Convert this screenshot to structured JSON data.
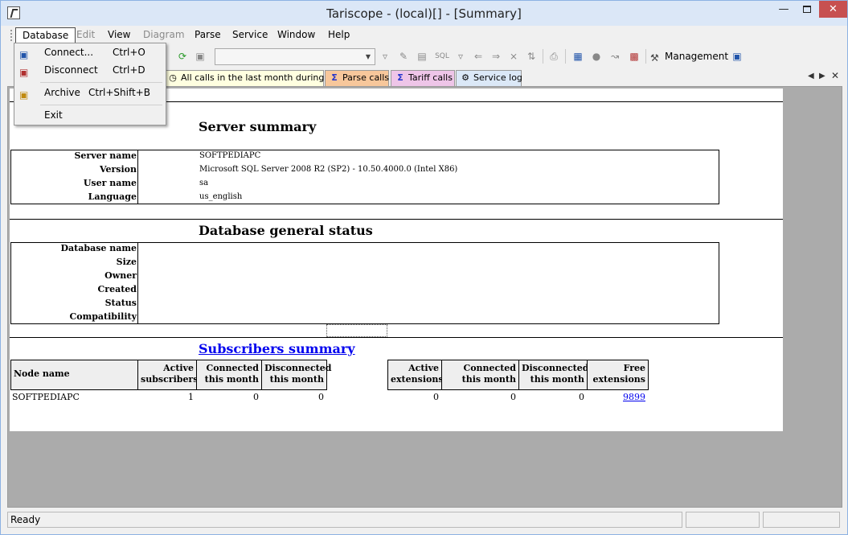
{
  "window": {
    "title": "Tariscope - (local)[] - [Summary]"
  },
  "menubar": {
    "items": [
      {
        "label": "Database"
      },
      {
        "label": "Edit"
      },
      {
        "label": "View"
      },
      {
        "label": "Diagram"
      },
      {
        "label": "Parse"
      },
      {
        "label": "Service"
      },
      {
        "label": "Window"
      },
      {
        "label": "Help"
      }
    ]
  },
  "database_menu": {
    "items": [
      {
        "label": "Connect...",
        "shortcut": "Ctrl+O"
      },
      {
        "label": "Disconnect",
        "shortcut": "Ctrl+D"
      },
      {
        "label": "Archive",
        "shortcut": "Ctrl+Shift+B"
      },
      {
        "label": "Exit",
        "shortcut": ""
      }
    ]
  },
  "toolbar": {
    "management_label": "Management"
  },
  "tabs": [
    {
      "label": "All calls in the last month during off-h",
      "color": "#ffffe0"
    },
    {
      "label": "Parse calls",
      "color": "#f7c79b"
    },
    {
      "label": "Tariff calls",
      "color": "#eec5e8"
    },
    {
      "label": "Service log",
      "color": "#dbe8f7"
    }
  ],
  "server_summary": {
    "title": "Server summary",
    "rows": [
      {
        "label": "Server name",
        "value": "SOFTPEDIAPC"
      },
      {
        "label": "Version",
        "value": "Microsoft SQL Server 2008 R2 (SP2) - 10.50.4000.0 (Intel X86)"
      },
      {
        "label": "User name",
        "value": "sa"
      },
      {
        "label": "Language",
        "value": "us_english"
      }
    ]
  },
  "db_status": {
    "title": "Database general status",
    "rows": [
      {
        "label": "Database name"
      },
      {
        "label": "Size"
      },
      {
        "label": "Owner"
      },
      {
        "label": "Created"
      },
      {
        "label": "Status"
      },
      {
        "label": "Compatibility"
      }
    ]
  },
  "subscribers": {
    "title": "Subscribers summary",
    "headers_left": [
      "Node name",
      "Active subscribers",
      "Connected this month",
      "Disconnected this month"
    ],
    "headers_right": [
      "Active extensions",
      "Connected this month",
      "Disconnected this month",
      "Free extensions"
    ],
    "row": {
      "node": "SOFTPEDIAPC",
      "active_subscribers": "1",
      "connected": "0",
      "disconnected": "0",
      "active_ext": "0",
      "connected_ext": "0",
      "disconnected_ext": "0",
      "free_ext": "9899"
    }
  },
  "status": {
    "text": "Ready"
  }
}
